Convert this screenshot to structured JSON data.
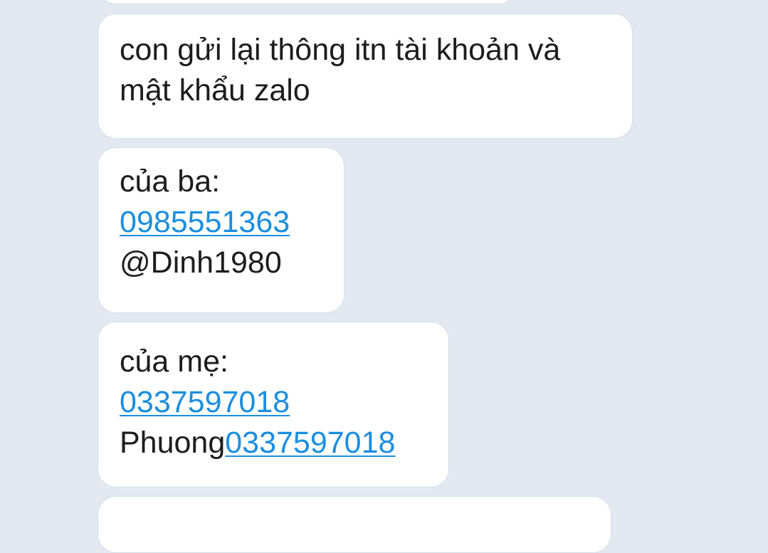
{
  "messages": [
    {
      "line1": "con gửi lại thông itn tài khoản và",
      "line2": "mật khẩu zalo"
    },
    {
      "label": "của ba:",
      "phone": "0985551363",
      "extra": "@Dinh1980"
    },
    {
      "label": "của mẹ:",
      "phone": "0337597018",
      "extra_text": "Phuong",
      "extra_phone": "0337597018"
    }
  ],
  "colors": {
    "background": "#e2e9f1",
    "bubble": "#ffffff",
    "text": "#1d1d1f",
    "link": "#1a8ee0"
  }
}
